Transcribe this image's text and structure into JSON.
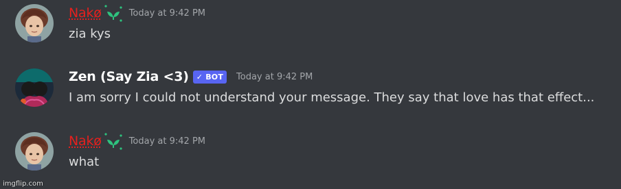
{
  "messages": [
    {
      "username": "Nakø",
      "username_color": "#e5201e",
      "badge_icon": "sprout-icon",
      "timestamp": "Today at 9:42 PM",
      "text": "zia kys"
    },
    {
      "username": "Zen (Say Zia <3)",
      "username_color": "#ffffff",
      "bot_tag": {
        "check": "✓",
        "label": "BOT"
      },
      "timestamp": "Today at 9:42 PM",
      "text": "I am sorry I could not understand your message. They say that love has that effect..."
    },
    {
      "username": "Nakø",
      "username_color": "#e5201e",
      "badge_icon": "sprout-icon",
      "timestamp": "Today at 9:42 PM",
      "text": "what"
    }
  ],
  "watermark": "imgflip.com",
  "colors": {
    "background": "#35383d",
    "bot_tag": "#5865f2",
    "sprout": "#2ec27e"
  }
}
